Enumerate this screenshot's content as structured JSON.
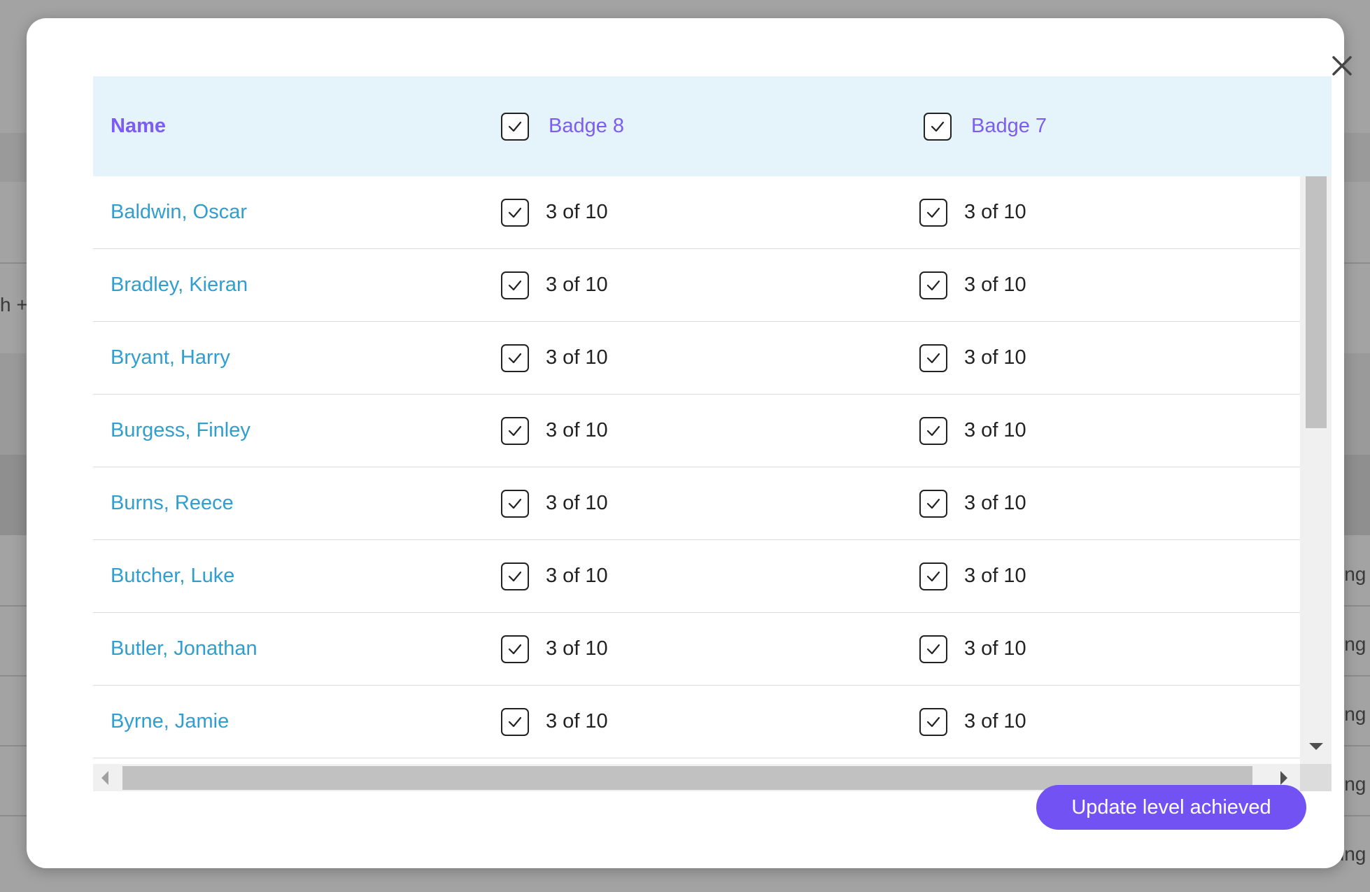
{
  "background": {
    "fragments": [
      "h +",
      "ing",
      "ing",
      "ing",
      "ing",
      "ing"
    ]
  },
  "modal": {
    "close_icon": "close-icon",
    "columns": {
      "name": "Name",
      "badge_a": "Badge 8",
      "badge_b": "Badge 7"
    },
    "rows": [
      {
        "name": "Baldwin, Oscar",
        "badge_a": "3 of 10",
        "badge_b": "3 of 10"
      },
      {
        "name": "Bradley, Kieran",
        "badge_a": "3 of 10",
        "badge_b": "3 of 10"
      },
      {
        "name": "Bryant, Harry",
        "badge_a": "3 of 10",
        "badge_b": "3 of 10"
      },
      {
        "name": "Burgess, Finley",
        "badge_a": "3 of 10",
        "badge_b": "3 of 10"
      },
      {
        "name": "Burns, Reece",
        "badge_a": "3 of 10",
        "badge_b": "3 of 10"
      },
      {
        "name": "Butcher, Luke",
        "badge_a": "3 of 10",
        "badge_b": "3 of 10"
      },
      {
        "name": "Butler, Jonathan",
        "badge_a": "3 of 10",
        "badge_b": "3 of 10"
      },
      {
        "name": "Byrne, Jamie",
        "badge_a": "3 of 10",
        "badge_b": "3 of 10"
      }
    ],
    "update_button": "Update level achieved",
    "colors": {
      "accent": "#7352f4",
      "header_bg": "#e5f4fa",
      "link": "#2f9ed0"
    }
  }
}
